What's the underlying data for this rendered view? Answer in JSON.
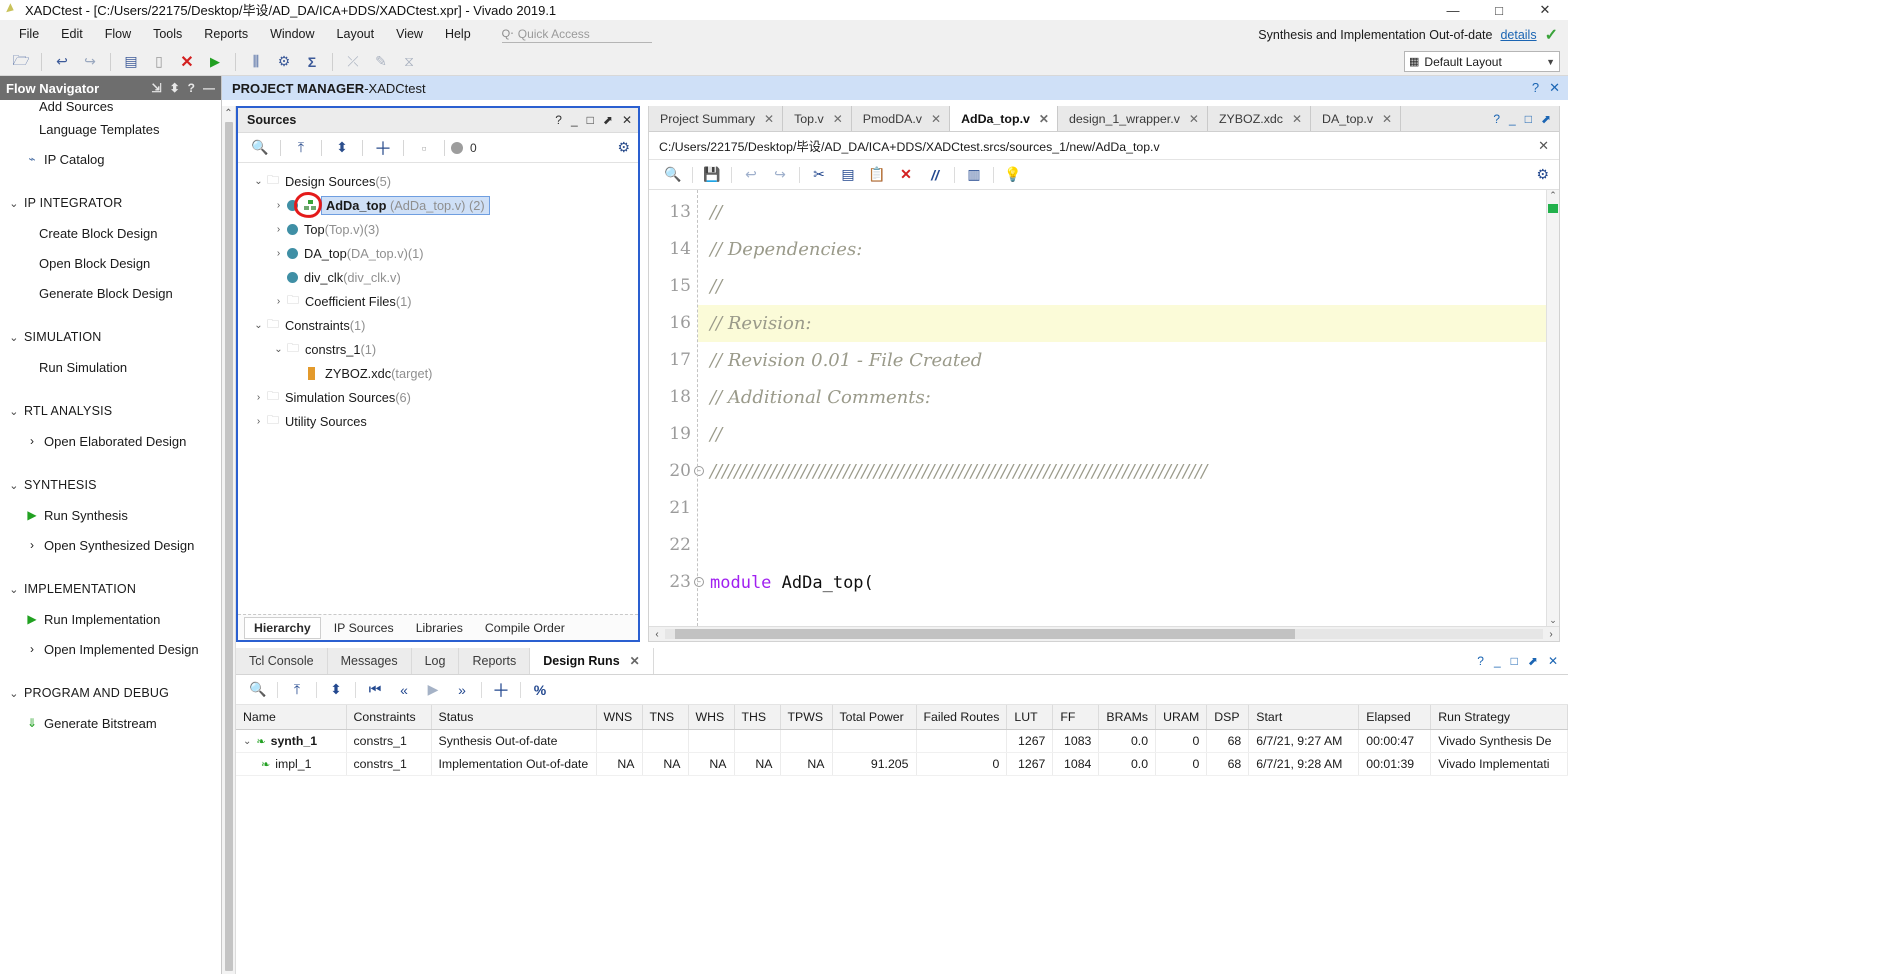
{
  "window": {
    "title": "XADCtest - [C:/Users/22175/Desktop/毕设/AD_DA/ICA+DDS/XADCtest.xpr] - Vivado 2019.1",
    "minimize": "—",
    "maximize": "□",
    "close": "✕"
  },
  "menu": {
    "items": [
      "File",
      "Edit",
      "Flow",
      "Tools",
      "Reports",
      "Window",
      "Layout",
      "View",
      "Help"
    ],
    "quick_access_placeholder": "Quick Access",
    "status_text": "Synthesis and Implementation Out-of-date",
    "status_link": "details"
  },
  "toolbar": {
    "layout_label": "Default Layout",
    "icons": [
      "open-project-icon",
      "undo-icon",
      "redo-icon",
      "report-icon",
      "window-icon",
      "close-icon",
      "run-icon",
      "ip-icon",
      "settings-icon",
      "sum-icon",
      "cross-probe-icon",
      "edit-icon",
      "schematic-icon"
    ]
  },
  "flow_navigator": {
    "title": "Flow Navigator",
    "items": [
      {
        "label": "Add Sources",
        "icon": "none",
        "level": "sub",
        "clipped": true
      },
      {
        "label": "Language Templates",
        "icon": "none",
        "level": "sub"
      },
      {
        "label": "IP Catalog",
        "icon": "ip-catalog-icon",
        "level": "sub"
      },
      {
        "label": "IP INTEGRATOR",
        "icon": "chevron-down-icon",
        "level": "section"
      },
      {
        "label": "Create Block Design",
        "icon": "none",
        "level": "sub"
      },
      {
        "label": "Open Block Design",
        "icon": "none",
        "level": "sub"
      },
      {
        "label": "Generate Block Design",
        "icon": "none",
        "level": "sub"
      },
      {
        "label": "SIMULATION",
        "icon": "chevron-down-icon",
        "level": "section"
      },
      {
        "label": "Run Simulation",
        "icon": "none",
        "level": "sub"
      },
      {
        "label": "RTL ANALYSIS",
        "icon": "chevron-down-icon",
        "level": "section"
      },
      {
        "label": "Open Elaborated Design",
        "icon": "chevron-right-icon",
        "level": "subarrow"
      },
      {
        "label": "SYNTHESIS",
        "icon": "chevron-down-icon",
        "level": "section"
      },
      {
        "label": "Run Synthesis",
        "icon": "play-icon",
        "level": "subicon"
      },
      {
        "label": "Open Synthesized Design",
        "icon": "chevron-right-icon",
        "level": "subarrow"
      },
      {
        "label": "IMPLEMENTATION",
        "icon": "chevron-down-icon",
        "level": "section"
      },
      {
        "label": "Run Implementation",
        "icon": "play-icon",
        "level": "subicon"
      },
      {
        "label": "Open Implemented Design",
        "icon": "chevron-right-icon",
        "level": "subarrow"
      },
      {
        "label": "PROGRAM AND DEBUG",
        "icon": "chevron-down-icon",
        "level": "section"
      },
      {
        "label": "Generate Bitstream",
        "icon": "bitstream-icon",
        "level": "subicon"
      }
    ]
  },
  "project_manager": {
    "prefix": "PROJECT MANAGER",
    "separator": " - ",
    "name": "XADCtest"
  },
  "sources": {
    "title": "Sources",
    "badge_count": "0",
    "tree": [
      {
        "label": "Design Sources",
        "suffix": " (5)",
        "icon": "folder-icon",
        "twisty": "v",
        "indent": 0
      },
      {
        "label": "AdDa_top",
        "file": " (AdDa_top.v)",
        "suffix": " (2)",
        "icon": "module-icon",
        "twisty": ">",
        "indent": 1,
        "selected": true,
        "annotated": true
      },
      {
        "label": "Top",
        "file": " (Top.v)",
        "suffix": " (3)",
        "icon": "dot-icon",
        "twisty": ">",
        "indent": 1
      },
      {
        "label": "DA_top",
        "file": " (DA_top.v)",
        "suffix": " (1)",
        "icon": "dot-icon",
        "twisty": ">",
        "indent": 1
      },
      {
        "label": "div_clk",
        "file": " (div_clk.v)",
        "suffix": "",
        "icon": "dot-icon",
        "twisty": "",
        "indent": 1
      },
      {
        "label": "Coefficient Files",
        "suffix": " (1)",
        "icon": "folder-icon",
        "twisty": ">",
        "indent": 1
      },
      {
        "label": "Constraints",
        "suffix": " (1)",
        "icon": "folder-icon",
        "twisty": "v",
        "indent": 0
      },
      {
        "label": "constrs_1",
        "suffix": " (1)",
        "icon": "folder-icon",
        "twisty": "v",
        "indent": 1
      },
      {
        "label": "ZYBOZ.xdc",
        "file": " (target)",
        "suffix": "",
        "icon": "xdc-file-icon",
        "twisty": "",
        "indent": 2
      },
      {
        "label": "Simulation Sources",
        "suffix": " (6)",
        "icon": "folder-icon",
        "twisty": ">",
        "indent": 0
      },
      {
        "label": "Utility Sources",
        "suffix": "",
        "icon": "folder-icon",
        "twisty": ">",
        "indent": 0
      }
    ],
    "tabs": [
      "Hierarchy",
      "IP Sources",
      "Libraries",
      "Compile Order"
    ],
    "active_tab": "Hierarchy"
  },
  "editor": {
    "tabs": [
      {
        "label": "Project Summary",
        "active": false
      },
      {
        "label": "Top.v",
        "active": false
      },
      {
        "label": "PmodDA.v",
        "active": false
      },
      {
        "label": "AdDa_top.v",
        "active": true
      },
      {
        "label": "design_1_wrapper.v",
        "active": false
      },
      {
        "label": "ZYBOZ.xdc",
        "active": false
      },
      {
        "label": "DA_top.v",
        "active": false
      }
    ],
    "path": "C:/Users/22175/Desktop/毕设/AD_DA/ICA+DDS/XADCtest.srcs/sources_1/new/AdDa_top.v",
    "lines": [
      {
        "no": "13",
        "text": "//",
        "type": "comment",
        "highlight": false,
        "fold": false
      },
      {
        "no": "14",
        "text": "// Dependencies:",
        "type": "comment",
        "highlight": false,
        "fold": false
      },
      {
        "no": "15",
        "text": "//",
        "type": "comment",
        "highlight": false,
        "fold": false
      },
      {
        "no": "16",
        "text": "// Revision:",
        "type": "comment",
        "highlight": true,
        "fold": false
      },
      {
        "no": "17",
        "text": "// Revision 0.01 - File Created",
        "type": "comment",
        "highlight": false,
        "fold": false
      },
      {
        "no": "18",
        "text": "// Additional Comments:",
        "type": "comment",
        "highlight": false,
        "fold": false
      },
      {
        "no": "19",
        "text": "//",
        "type": "comment",
        "highlight": false,
        "fold": false
      },
      {
        "no": "20",
        "text": "//////////////////////////////////////////////////////////////////////////////////",
        "type": "comment",
        "highlight": false,
        "fold": true
      },
      {
        "no": "21",
        "text": "",
        "type": "plain",
        "highlight": false,
        "fold": false
      },
      {
        "no": "22",
        "text": "",
        "type": "plain",
        "highlight": false,
        "fold": false
      },
      {
        "no": "23",
        "keyword": "module",
        "text": " AdDa_top(",
        "type": "code",
        "highlight": false,
        "fold": true
      }
    ]
  },
  "console": {
    "tabs": [
      {
        "label": "Tcl Console",
        "active": false,
        "closable": false
      },
      {
        "label": "Messages",
        "active": false,
        "closable": false
      },
      {
        "label": "Log",
        "active": false,
        "closable": false
      },
      {
        "label": "Reports",
        "active": false,
        "closable": false
      },
      {
        "label": "Design Runs",
        "active": true,
        "closable": true
      }
    ],
    "columns": [
      "Name",
      "Constraints",
      "Status",
      "WNS",
      "TNS",
      "WHS",
      "THS",
      "TPWS",
      "Total Power",
      "Failed Routes",
      "LUT",
      "FF",
      "BRAMs",
      "URAM",
      "DSP",
      "Start",
      "Elapsed",
      "Run Strategy"
    ],
    "rows": [
      {
        "name": "synth_1",
        "twisty": "v",
        "constraints": "constrs_1",
        "status": "Synthesis Out-of-date",
        "wns": "",
        "tns": "",
        "whs": "",
        "ths": "",
        "tpws": "",
        "total_power": "",
        "failed_routes": "",
        "lut": "1267",
        "ff": "1083",
        "brams": "0.0",
        "uram": "0",
        "dsp": "68",
        "start": "6/7/21, 9:27 AM",
        "elapsed": "00:00:47",
        "run_strategy": "Vivado Synthesis De"
      },
      {
        "name": "impl_1",
        "twisty": "",
        "constraints": "constrs_1",
        "status": "Implementation Out-of-date",
        "wns": "NA",
        "tns": "NA",
        "whs": "NA",
        "ths": "NA",
        "tpws": "NA",
        "total_power": "91.205",
        "failed_routes": "0",
        "lut": "1267",
        "ff": "1084",
        "brams": "0.0",
        "uram": "0",
        "dsp": "68",
        "start": "6/7/21, 9:28 AM",
        "elapsed": "00:01:39",
        "run_strategy": "Vivado Implementati"
      }
    ]
  }
}
